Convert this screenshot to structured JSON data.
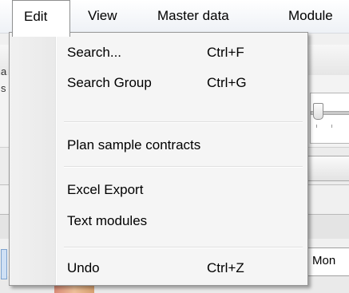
{
  "menubar": {
    "items": [
      {
        "label": "Edit"
      },
      {
        "label": "View"
      },
      {
        "label": "Master data"
      },
      {
        "label": "Module"
      }
    ]
  },
  "edit_menu": {
    "items": [
      {
        "label": "Search...",
        "shortcut": "Ctrl+F"
      },
      {
        "label": "Search Group",
        "shortcut": "Ctrl+G"
      },
      {
        "label": "Plan sample contracts",
        "shortcut": ""
      },
      {
        "label": "Excel Export",
        "shortcut": ""
      },
      {
        "label": "Text modules",
        "shortcut": ""
      },
      {
        "label": "Undo",
        "shortcut": "Ctrl+Z"
      }
    ]
  },
  "background": {
    "left_fragment_1": "a",
    "left_fragment_2": "s",
    "grid_cell_text": "Mon"
  }
}
